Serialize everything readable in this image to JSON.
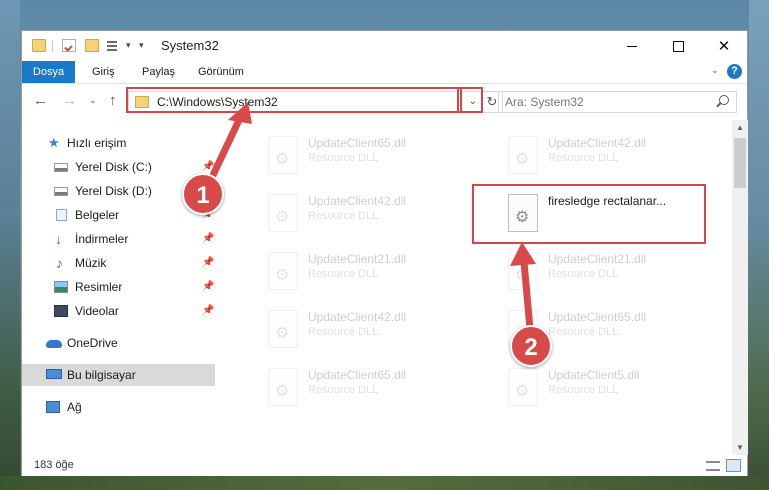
{
  "window": {
    "title": "System32",
    "quick_access_toolbar": {
      "dropdown_glyph": "▾",
      "pin_glyph": "▾"
    },
    "controls": {
      "minimize": "",
      "maximize": "",
      "close": "✕"
    }
  },
  "ribbon": {
    "tabs": [
      "Dosya",
      "Giriş",
      "Paylaş",
      "Görünüm"
    ],
    "chevron": "⌄",
    "help": "?"
  },
  "navigation": {
    "back": "←",
    "forward": "→",
    "recent": "⌄",
    "up": "↑",
    "address": "C:\\Windows\\System32",
    "address_dropdown": "⌄",
    "refresh": "↻",
    "search_placeholder": "Ara: System32"
  },
  "sidebar": {
    "items": [
      {
        "label": "Hızlı erişim",
        "icon": "star-icon",
        "pinned": false
      },
      {
        "label": "Yerel Disk (C:)",
        "icon": "disk-icon",
        "pinned": true
      },
      {
        "label": "Yerel Disk (D:)",
        "icon": "disk-icon",
        "pinned": true
      },
      {
        "label": "Belgeler",
        "icon": "document-icon",
        "pinned": true
      },
      {
        "label": "İndirmeler",
        "icon": "download-icon",
        "pinned": true
      },
      {
        "label": "Müzik",
        "icon": "music-icon",
        "pinned": true
      },
      {
        "label": "Resimler",
        "icon": "pictures-icon",
        "pinned": true
      },
      {
        "label": "Videolar",
        "icon": "videos-icon",
        "pinned": true
      },
      {
        "label": "OneDrive",
        "icon": "cloud-icon",
        "pinned": false
      },
      {
        "label": "Bu bilgisayar",
        "icon": "computer-icon",
        "pinned": false,
        "selected": true
      },
      {
        "label": "Ağ",
        "icon": "network-icon",
        "pinned": false
      }
    ],
    "pin_glyph": "📌"
  },
  "files": [
    {
      "name": "UpdateClient65.dll",
      "type": "Resource DLL"
    },
    {
      "name": "UpdateClient42.dll",
      "type": "Resource DLL"
    },
    {
      "name": "UpdateClient42.dll",
      "type": "Resource DLL"
    },
    {
      "name": "firesledge rectalanar...",
      "type": "",
      "highlighted": true
    },
    {
      "name": "UpdateClient21.dll",
      "type": "Resource DLL"
    },
    {
      "name": "UpdateClient21.dll",
      "type": "Resource DLL"
    },
    {
      "name": "UpdateClient42.dll",
      "type": "Resource DLL"
    },
    {
      "name": "UpdateClient65.dll",
      "type": "Resource DLL"
    },
    {
      "name": "UpdateClient65.dll",
      "type": "Resource DLL"
    },
    {
      "name": "UpdateClient5.dll",
      "type": "Resource DLL"
    }
  ],
  "statusbar": {
    "item_count": "183 öğe"
  },
  "scrollbar": {
    "up": "▲",
    "down": "▼"
  },
  "annotations": {
    "step1": "1",
    "step2": "2",
    "accent": "#d84a4a"
  }
}
